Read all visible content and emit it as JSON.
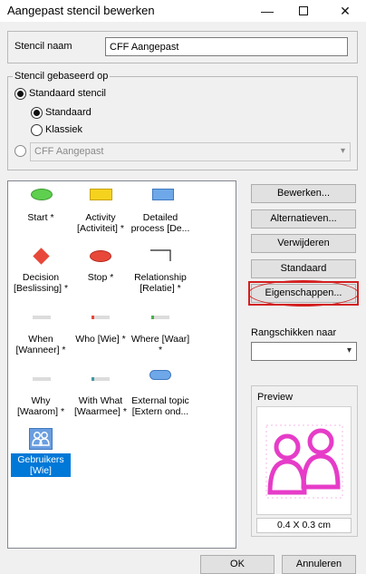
{
  "window": {
    "title": "Aangepast stencil bewerken",
    "minimize_glyph": "—",
    "close_glyph": "✕"
  },
  "stencil_name": {
    "label": "Stencil naam",
    "value": "CFF Aangepast"
  },
  "based_on": {
    "group_label": "Stencil gebaseerd op",
    "standard_stencil": "Standaard stencil",
    "standard": "Standaard",
    "classic": "Klassiek",
    "custom_value": "CFF Aangepast"
  },
  "shapes": [
    {
      "label": "Start *",
      "icon": "green-ellipse-icon"
    },
    {
      "label": "Activity [Activiteit] *",
      "icon": "yellow-rectangle-icon"
    },
    {
      "label": "Detailed process [De...",
      "icon": "blue-rectangle-icon"
    },
    {
      "label": "Decision [Beslissing] *",
      "icon": "red-diamond-icon"
    },
    {
      "label": "Stop *",
      "icon": "red-ellipse-icon"
    },
    {
      "label": "Relationship [Relatie] *",
      "icon": "connector-line-icon"
    },
    {
      "label": "When [Wanneer] *",
      "icon": "small-bar-icon"
    },
    {
      "label": "Who [Wie] *",
      "icon": "small-bar-icon"
    },
    {
      "label": "Where [Waar] *",
      "icon": "small-bar-icon"
    },
    {
      "label": "Why [Waarom] *",
      "icon": "small-bar-icon"
    },
    {
      "label": "With What [Waarmee] *",
      "icon": "small-bar-icon"
    },
    {
      "label": "External topic [Extern ond...",
      "icon": "blue-capsule-icon"
    },
    {
      "label": "Gebruikers [Wie]",
      "icon": "users-icon"
    }
  ],
  "buttons": {
    "edit": "Bewerken...",
    "alternatives": "Alternatieven...",
    "delete": "Verwijderen",
    "default": "Standaard",
    "properties": "Eigenschappen...",
    "ok": "OK",
    "cancel": "Annuleren"
  },
  "sort": {
    "label": "Rangschikken naar",
    "value": ""
  },
  "preview": {
    "label": "Preview",
    "size": "0.4 X 0.3 cm"
  },
  "colors": {
    "accent": "#0078d7",
    "highlight": "#d21f1f",
    "preview_magenta": "#e63cc8"
  }
}
